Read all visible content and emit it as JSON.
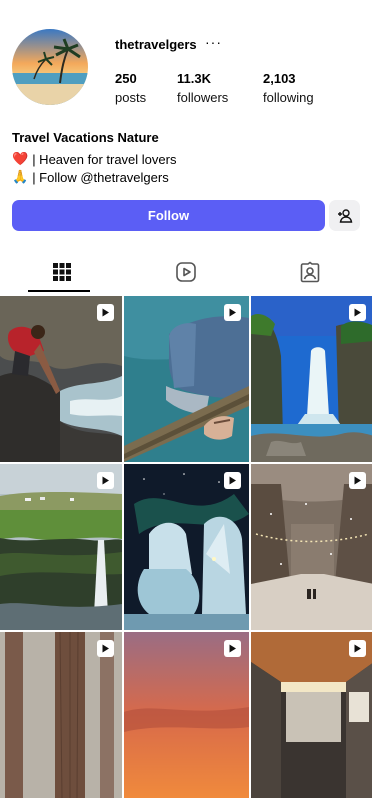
{
  "profile": {
    "username": "thetravelgers",
    "more_label": "···",
    "stats": [
      {
        "value": "250",
        "label": "posts"
      },
      {
        "value": "11.3K",
        "label": "followers"
      },
      {
        "value": "2,103",
        "label": "following"
      }
    ],
    "full_name": "Travel Vacations Nature",
    "bio": [
      {
        "emoji": "❤️",
        "text": "| Heaven for travel lovers"
      },
      {
        "emoji": "🙏",
        "text": "| Follow @thetravelgers"
      }
    ]
  },
  "actions": {
    "follow_label": "Follow",
    "add_user_icon": "add-user-icon"
  },
  "tabs": [
    {
      "icon": "grid-icon",
      "active": true
    },
    {
      "icon": "reels-icon",
      "active": false
    },
    {
      "icon": "tagged-icon",
      "active": false
    }
  ],
  "grid": {
    "badge_icon": "play-icon",
    "posts": [
      {
        "scene": "person-on-rocks-by-river"
      },
      {
        "scene": "boot-on-wooden-rail"
      },
      {
        "scene": "waterfall-blue-sky"
      },
      {
        "scene": "cliff-waterfall-green"
      },
      {
        "scene": "snowy-trees-aurora"
      },
      {
        "scene": "snowy-street-lights"
      },
      {
        "scene": "forest-trees-fog"
      },
      {
        "scene": "sunset-sky"
      },
      {
        "scene": "van-interior"
      }
    ]
  },
  "colors": {
    "follow_button": "#5b5ef5",
    "secondary_button": "#f0f0f2"
  }
}
